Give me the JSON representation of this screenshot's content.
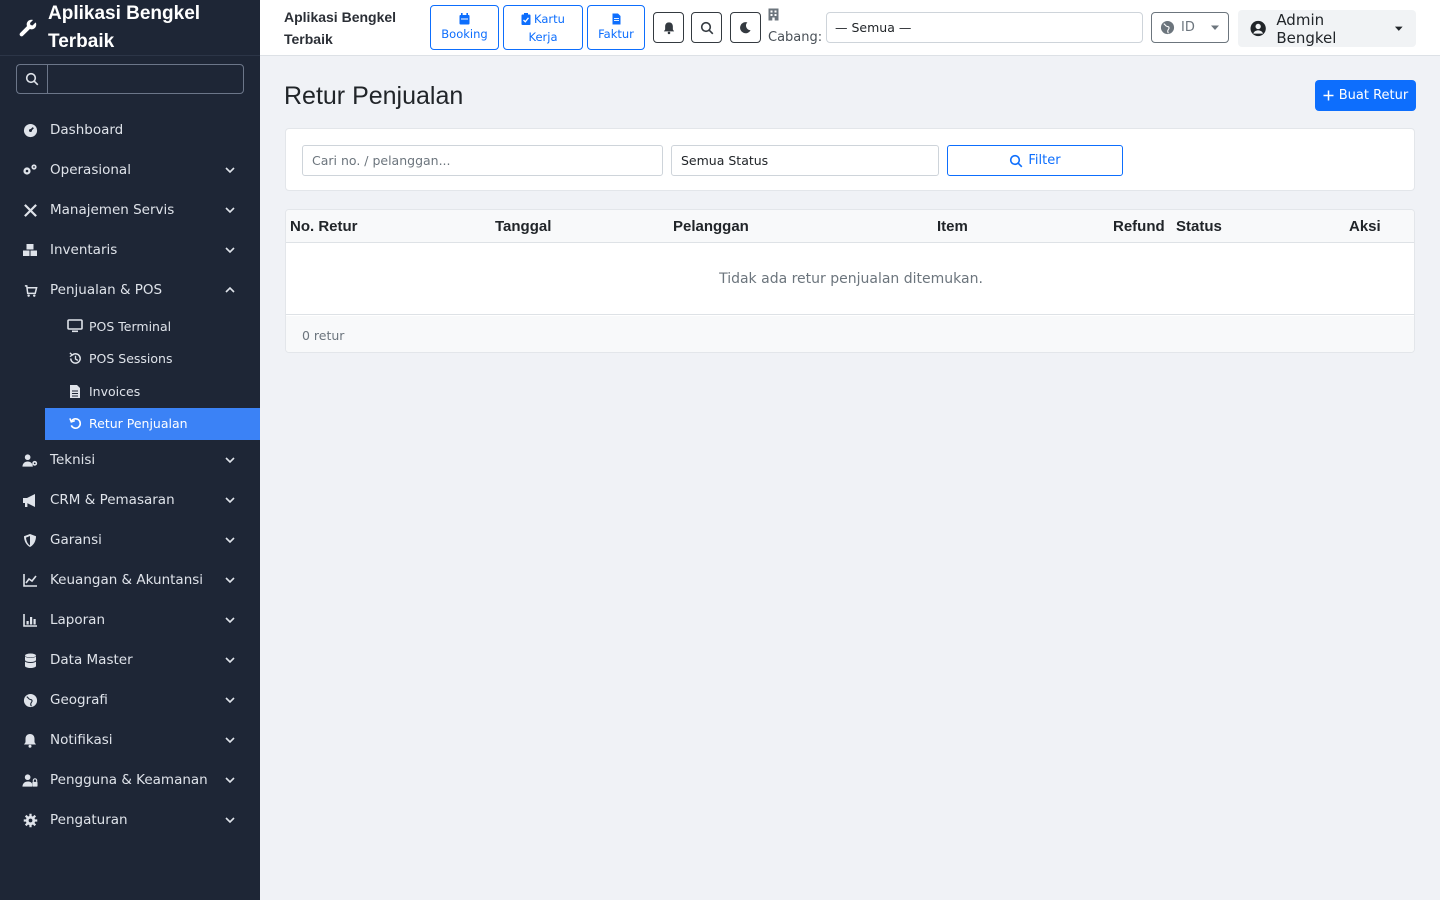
{
  "sidebar": {
    "brand": "Aplikasi Bengkel Terbaik",
    "search_placeholder": "",
    "items": [
      {
        "label": "Dashboard",
        "icon": "gauge-icon",
        "has_chevron": false
      },
      {
        "label": "Operasional",
        "icon": "gears-icon",
        "has_chevron": true
      },
      {
        "label": "Manajemen Servis",
        "icon": "tools-icon",
        "has_chevron": true
      },
      {
        "label": "Inventaris",
        "icon": "boxes-icon",
        "has_chevron": true
      },
      {
        "label": "Penjualan & POS",
        "icon": "cart-icon",
        "has_chevron": true,
        "expanded": true
      }
    ],
    "subitems": [
      {
        "label": "POS Terminal",
        "icon": "monitor-icon"
      },
      {
        "label": "POS Sessions",
        "icon": "history-icon"
      },
      {
        "label": "Invoices",
        "icon": "file-invoice-icon"
      },
      {
        "label": "Retur Penjualan",
        "icon": "undo-icon",
        "active": true
      }
    ],
    "items_after": [
      {
        "label": "Teknisi",
        "icon": "user-gear-icon"
      },
      {
        "label": "CRM & Pemasaran",
        "icon": "bullhorn-icon"
      },
      {
        "label": "Garansi",
        "icon": "shield-icon"
      },
      {
        "label": "Keuangan & Akuntansi",
        "icon": "chart-line-icon"
      },
      {
        "label": "Laporan",
        "icon": "chart-bar-icon"
      },
      {
        "label": "Data Master",
        "icon": "database-icon"
      },
      {
        "label": "Geografi",
        "icon": "globe-icon"
      },
      {
        "label": "Notifikasi",
        "icon": "bell-icon"
      },
      {
        "label": "Pengguna & Keamanan",
        "icon": "user-lock-icon"
      },
      {
        "label": "Pengaturan",
        "icon": "cog-icon"
      }
    ]
  },
  "topbar": {
    "title": "Aplikasi Bengkel Terbaik",
    "quick_buttons": [
      {
        "label": "Booking",
        "icon": "calendar-icon"
      },
      {
        "label": "Kartu Kerja",
        "icon": "clipboard-check-icon"
      },
      {
        "label": "Faktur",
        "icon": "file-icon"
      }
    ],
    "cabang_label": "Cabang:",
    "cabang_value": "— Semua —",
    "lang": "ID",
    "user": "Admin Bengkel"
  },
  "main": {
    "title": "Retur Penjualan",
    "create_button": "Buat Retur",
    "search_placeholder": "Cari no. / pelanggan...",
    "status_select": "Semua Status",
    "filter_button": "Filter",
    "columns": [
      "No. Retur",
      "Tanggal",
      "Pelanggan",
      "Item",
      "Refund",
      "Status",
      "Aksi"
    ],
    "empty_text": "Tidak ada retur penjualan ditemukan.",
    "footer_count": "0 retur"
  },
  "colors": {
    "sidebar_bg": "#1e2636",
    "active_bg": "#3b82f6",
    "primary": "#0d6efd"
  }
}
